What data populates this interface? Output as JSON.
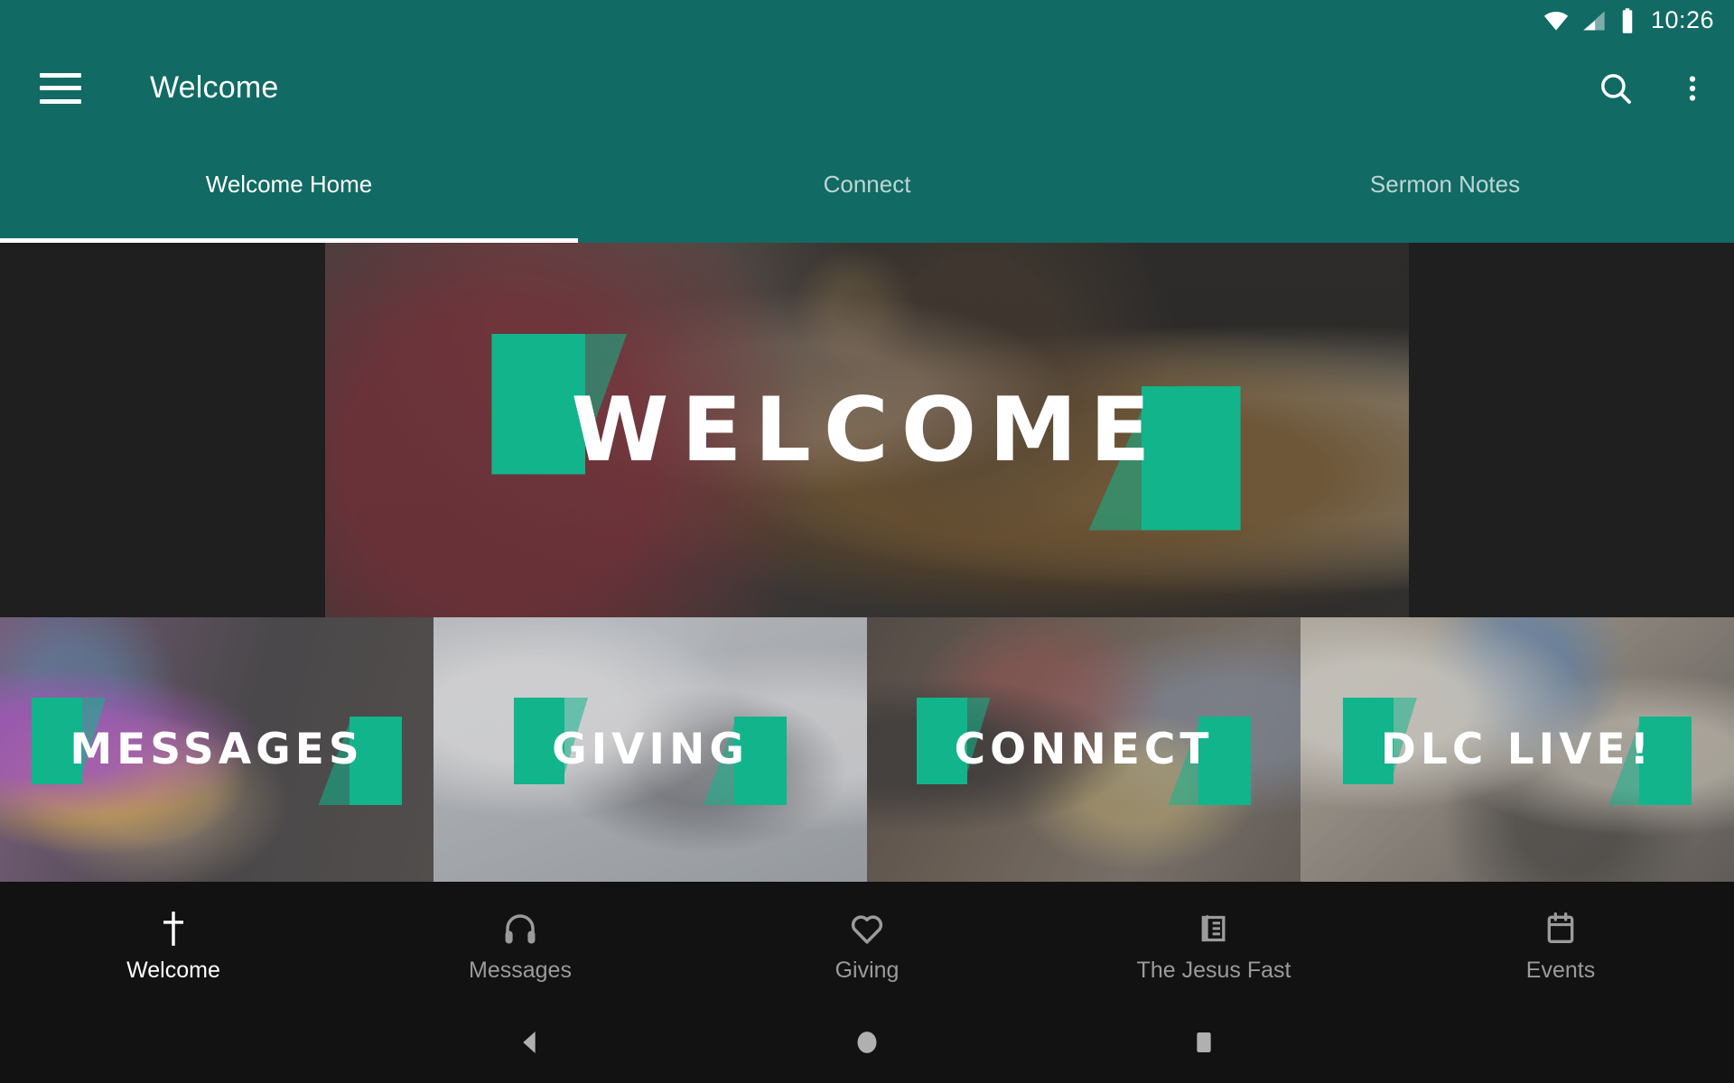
{
  "status_bar": {
    "time": "10:26",
    "icons": [
      "wifi-icon",
      "cellular-signal-icon",
      "battery-icon"
    ]
  },
  "app_bar": {
    "menu_icon": "hamburger-menu-icon",
    "title": "Welcome",
    "search_icon": "search-icon",
    "overflow_icon": "overflow-menu-icon"
  },
  "tabs": [
    {
      "label": "Welcome Home",
      "active": true
    },
    {
      "label": "Connect",
      "active": false
    },
    {
      "label": "Sermon Notes",
      "active": false
    }
  ],
  "hero": {
    "caption": "WELCOME"
  },
  "tiles": [
    {
      "label": "MESSAGES"
    },
    {
      "label": "GIVING"
    },
    {
      "label": "CONNECT"
    },
    {
      "label": "DLC LIVE!"
    }
  ],
  "bottom_nav": [
    {
      "label": "Welcome",
      "icon": "cross-icon",
      "active": true
    },
    {
      "label": "Messages",
      "icon": "headphones-icon",
      "active": false
    },
    {
      "label": "Giving",
      "icon": "heart-icon",
      "active": false
    },
    {
      "label": "The Jesus Fast",
      "icon": "book-icon",
      "active": false
    },
    {
      "label": "Events",
      "icon": "calendar-icon",
      "active": false
    }
  ],
  "system_nav": {
    "back": "back-triangle-icon",
    "home": "home-circle-icon",
    "recents": "recents-square-icon"
  },
  "colors": {
    "primary_teal": "#116A64",
    "accent_green": "#12B48C",
    "nav_background": "#121212",
    "page_background": "#1f1f1f"
  }
}
